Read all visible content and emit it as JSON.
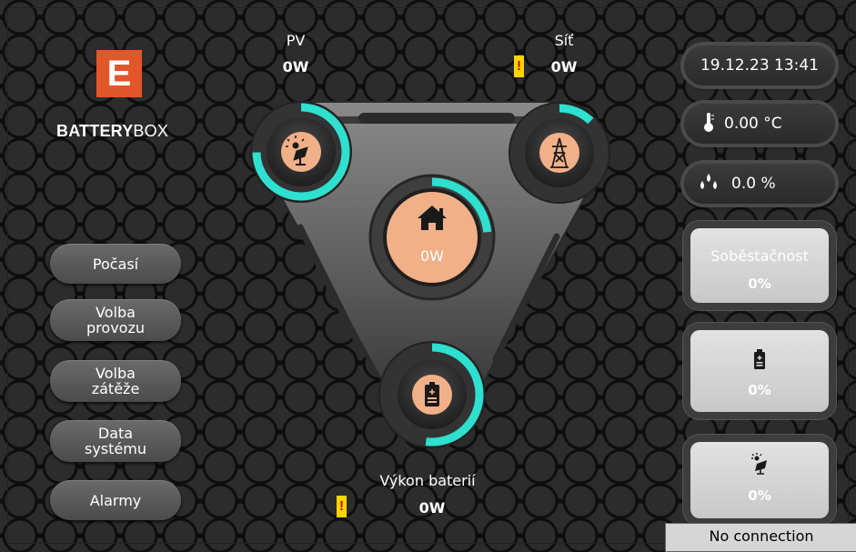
{
  "brand": {
    "bold": "BATTERY",
    "light": "BOX",
    "logo_letter": "E"
  },
  "nav": [
    {
      "label": "Počasí"
    },
    {
      "label": "Volba\nprovozu"
    },
    {
      "label": "Volba\nzátěže"
    },
    {
      "label": "Data\nsystému"
    },
    {
      "label": "Alarmy"
    }
  ],
  "flows": {
    "pv": {
      "label": "PV",
      "value": "0W"
    },
    "grid": {
      "label": "Síť",
      "value": "0W"
    },
    "home": {
      "value": "0W"
    },
    "battery": {
      "label": "Výkon baterií",
      "value": "0W"
    }
  },
  "warning_glyph": "!",
  "status": {
    "datetime": "19.12.23 13:41",
    "temperature": "0.00 °C",
    "humidity": "0.0 %"
  },
  "cards": {
    "self_sufficiency": {
      "label": "Soběstačnost",
      "value": "0%"
    },
    "battery": {
      "value": "0%"
    },
    "solar": {
      "value": "0%"
    }
  },
  "footer": {
    "message": "No connection"
  },
  "colors": {
    "accent": "#2ee0d0",
    "orange": "#f1b088",
    "logo": "#e2562b",
    "warning": "#ffd400"
  }
}
